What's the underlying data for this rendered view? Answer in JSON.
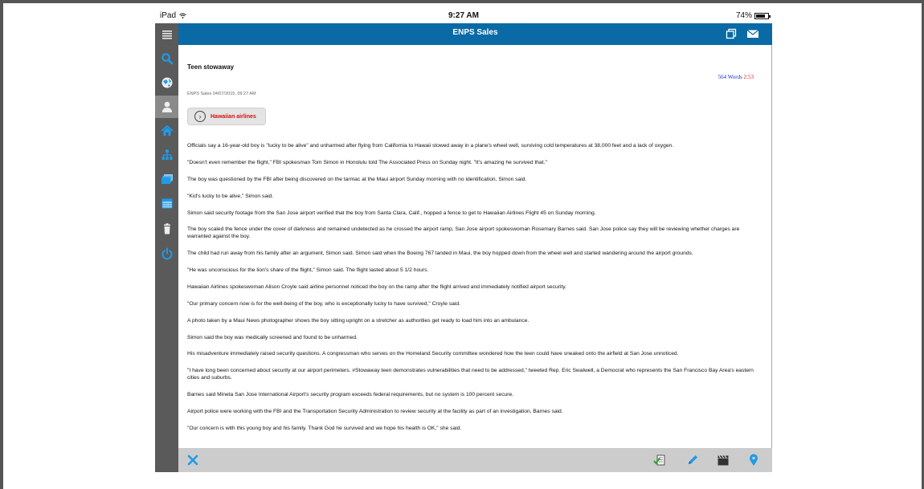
{
  "status": {
    "device": "iPad",
    "time": "9:27 AM",
    "battery": "74%",
    "battery_level": 0.74
  },
  "header": {
    "title": "ENPS Sales"
  },
  "sidebar": {
    "items": [
      {
        "name": "menu-icon"
      },
      {
        "name": "search-icon"
      },
      {
        "name": "globe-icon"
      },
      {
        "name": "user-icon"
      },
      {
        "name": "home-icon"
      },
      {
        "name": "hierarchy-icon"
      },
      {
        "name": "stack-icon"
      },
      {
        "name": "calendar-icon"
      },
      {
        "name": "trash-icon"
      },
      {
        "name": "power-icon"
      }
    ],
    "active_index": 3
  },
  "story": {
    "title": "Teen stowaway",
    "word_count": "564",
    "words_label": "Words",
    "duration": "2:53",
    "meta": "ENPS Sales  04/07/2015, 09:27 AM",
    "tag": "Hawaiian airlines",
    "paragraphs": [
      "Officials say a 16-year-old boy is \"lucky to be alive\" and unharmed after flying from California to Hawaii stowed away in a plane's wheel well, surviving cold temperatures at 38,000 feet and a lack of oxygen.",
      "\"Doesn't even remember the flight,\" FBI spokesman Tom Simon in Honolulu told The Associated Press on Sunday night. \"It's amazing he survived that.\"",
      "The boy was questioned by the FBI after being discovered on the tarmac at the Maui airport Sunday morning with no identification, Simon said.",
      "\"Kid's lucky to be alive,\" Simon said.",
      "Simon said security footage from the San Jose airport verified that the boy from Santa Clara, Calif., hopped a fence to get to Hawaiian Airlines Flight 45 on Sunday morning.",
      "The boy scaled the fence under the cover of darkness and remained undetected as he crossed the airport ramp, San Jose airport spokeswoman Rosemary Barnes said. San Jose police say they will be reviewing whether charges are warranted against the boy.",
      "The child had run away from his family after an argument, Simon said. Simon said when the Boeing 767 landed in Maui, the boy hopped down from the wheel well and started wandering around the airport grounds.",
      "\"He was unconscious for the lion's share of the flight,\" Simon said. The flight lasted about 5 1/2 hours.",
      "Hawaiian Airlines spokeswoman Alison Croyle said airline personnel noticed the boy on the ramp after the flight arrived and immediately notified airport security.",
      "\"Our primary concern now is for the well-being of the boy, who is exceptionally lucky to have survived,\" Croyle said.",
      "A photo taken by a Maui News photographer shows the boy sitting upright on a stretcher as authorities get ready to load him into an ambulance.",
      "Simon said the boy was medically screened and found to be unharmed.",
      "His misadventure immediately raised security questions. A congressman who serves on the Homeland Security committee wondered how the teen could have sneaked onto the airfield at San Jose unnoticed.",
      "\"I have long been concerned about security at our airport perimeters. #Stowaway teen demonstrates vulnerabilities that need to be addressed,\" tweeted Rep. Eric Swalwell, a Democrat who represents the San Francisco Bay Area's eastern cities and suburbs.",
      "Barnes said Mineta San Jose International Airport's security program exceeds federal requirements, but no system is 100 percent secure.",
      "Airport police were working with the FBI and the Transportation Security Administration to review security at the facility as part of an investigation, Barnes said.",
      "\"Our concern is with this young boy and his family. Thank God he survived and we hope his health is OK,\" she said."
    ]
  },
  "colors": {
    "header": "#0a6aa5",
    "sidebar": "#5a5a5a",
    "icon_blue": "#1e9be8",
    "tag_red": "#d41010",
    "word_count_blue": "#2030c0",
    "duration_red": "#d02020"
  }
}
